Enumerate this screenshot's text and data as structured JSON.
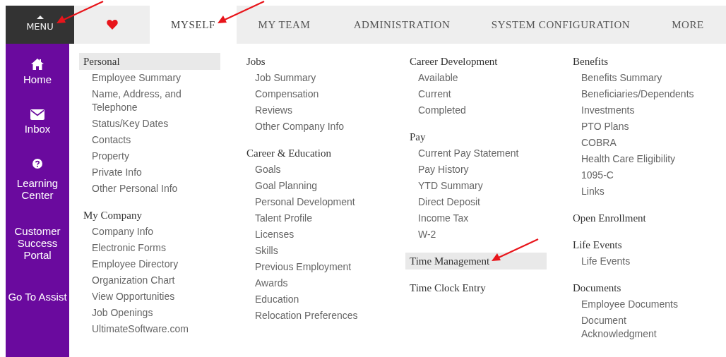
{
  "menu_button": {
    "label": "MENU",
    "arrow": true
  },
  "tabs": [
    {
      "kind": "icon",
      "selected": false
    },
    {
      "kind": "text",
      "label": "MYSELF",
      "selected": true,
      "arrow": true
    },
    {
      "kind": "text",
      "label": "MY TEAM",
      "selected": false
    },
    {
      "kind": "text",
      "label": "ADMINISTRATION",
      "selected": false
    },
    {
      "kind": "text",
      "label": "SYSTEM CONFIGURATION",
      "selected": false
    },
    {
      "kind": "text",
      "label": "MORE",
      "selected": false
    }
  ],
  "sidebar": {
    "items": [
      {
        "kind": "home",
        "label": "Home"
      },
      {
        "kind": "inbox",
        "label": "Inbox"
      },
      {
        "kind": "help",
        "label": "Learning Center"
      },
      {
        "kind": "link",
        "label": "Customer Success Portal"
      },
      {
        "kind": "link",
        "label": "Go To Assist"
      }
    ]
  },
  "columns": [
    {
      "sections": [
        {
          "heading": "Personal",
          "highlighted": true,
          "items": [
            "Employee Summary",
            "Name, Address, and Telephone",
            "Status/Key Dates",
            "Contacts",
            "Property",
            "Private Info",
            "Other Personal Info"
          ]
        },
        {
          "heading": "My Company",
          "highlighted": false,
          "items": [
            "Company Info",
            "Electronic Forms",
            "Employee Directory",
            "Organization Chart",
            "View Opportunities",
            "Job Openings",
            "UltimateSoftware.com"
          ]
        }
      ]
    },
    {
      "sections": [
        {
          "heading": "Jobs",
          "highlighted": false,
          "items": [
            "Job Summary",
            "Compensation",
            "Reviews",
            "Other Company Info"
          ]
        },
        {
          "heading": "Career & Education",
          "highlighted": false,
          "items": [
            "Goals",
            "Goal Planning",
            "Personal Development",
            "Talent Profile",
            "Licenses",
            "Skills",
            "Previous Employment",
            "Awards",
            "Education",
            "Relocation Preferences"
          ]
        }
      ]
    },
    {
      "sections": [
        {
          "heading": "Career Development",
          "highlighted": false,
          "items": [
            "Available",
            "Current",
            "Completed"
          ]
        },
        {
          "heading": "Pay",
          "highlighted": false,
          "items": [
            "Current Pay Statement",
            "Pay History",
            "YTD Summary",
            "Direct Deposit",
            "Income Tax",
            "W-2"
          ]
        },
        {
          "heading": "Time Management",
          "highlighted": true,
          "arrow": true
        },
        {
          "heading": "Time Clock Entry",
          "highlighted": false
        }
      ]
    },
    {
      "sections": [
        {
          "heading": "Benefits",
          "highlighted": false,
          "items": [
            "Benefits Summary",
            "Beneficiaries/Dependents",
            "Investments",
            "PTO Plans",
            "COBRA",
            "Health Care Eligibility",
            "1095-C",
            "Links"
          ]
        },
        {
          "heading": "Open Enrollment",
          "highlighted": false
        },
        {
          "heading": "Life Events",
          "highlighted": false,
          "items": [
            "Life Events"
          ]
        },
        {
          "heading": "Documents",
          "highlighted": false,
          "items": [
            "Employee Documents",
            "Document Acknowledgment"
          ]
        }
      ]
    }
  ]
}
